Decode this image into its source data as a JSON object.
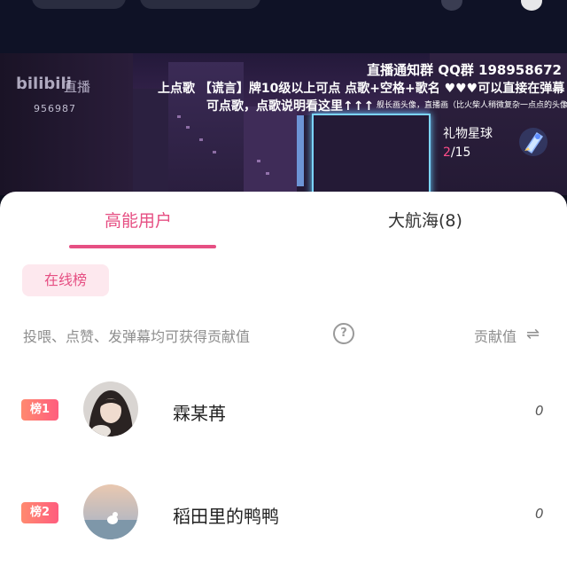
{
  "banner": {
    "logo": "bilibili",
    "logo_sub": "直播",
    "room_id": "956987",
    "notice_line1": "直播通知群  QQ群 198958672",
    "notice_line2": "上点歌  【谎言】牌10级以上可点  点歌+空格+歌名  ♥♥♥可以直接在弹幕",
    "notice_line3": "可点歌，点歌说明看这里↑↑↑",
    "notice_line3_small": "舰长画头像，直播画（比火柴人稍微复杂一点点的头像）",
    "gift_title": "礼物星球",
    "gift_progress_current": "2",
    "gift_progress_total": "/15"
  },
  "tabs": [
    {
      "label": "高能用户",
      "active": true
    },
    {
      "label": "大航海(8)",
      "active": false
    }
  ],
  "chip_label": "在线榜",
  "hint_text": "投喂、点赞、发弹幕均可获得贡献值",
  "column_header": "贡献值",
  "users": [
    {
      "rank": "榜1",
      "name": "霖某苒",
      "score": "0"
    },
    {
      "rank": "榜2",
      "name": "稻田里的鸭鸭",
      "score": "0"
    }
  ],
  "colors": {
    "accent": "#e64f83",
    "chip_bg": "#fde8ee",
    "badge_gradient_start": "#ff8a6f",
    "badge_gradient_end": "#ff5d7e"
  },
  "icons": [
    "help-icon",
    "swap-icon",
    "rocket-icon"
  ]
}
